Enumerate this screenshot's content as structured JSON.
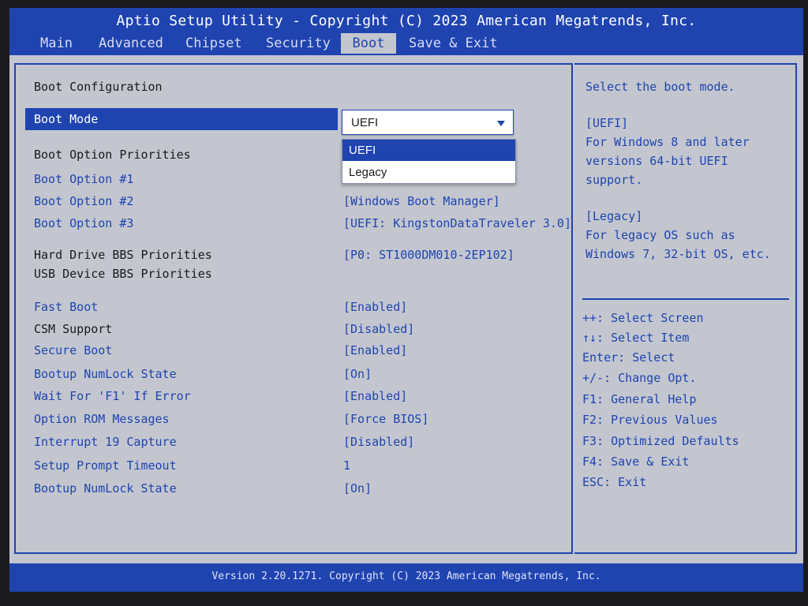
{
  "app_title": "Aptio Setup Utility - Copyright (C) 2023 American Megatrends, Inc.",
  "tabs": [
    {
      "label": "Main"
    },
    {
      "label": "Advanced"
    },
    {
      "label": "Chipset"
    },
    {
      "label": "Security"
    },
    {
      "label": "Boot",
      "active": true
    },
    {
      "label": "Save & Exit"
    }
  ],
  "main": {
    "section_boot_config": "Boot Configuration",
    "boot_mode": {
      "label": "Boot Mode",
      "value": "UEFI",
      "options": [
        "UEFI",
        "Legacy"
      ],
      "selected_option": "UEFI"
    },
    "section_priorities": "Boot Option Priorities",
    "boot_options": [
      {
        "label": "Boot Option #1",
        "value": ""
      },
      {
        "label": "Boot Option #2",
        "value": "[Windows Boot Manager]"
      },
      {
        "label": "Boot Option #3",
        "value": "[UEFI: KingstonDataTraveler 3.0]"
      }
    ],
    "hdd_bbs": {
      "label": "Hard Drive BBS Priorities",
      "value": "[P0: ST1000DM010-2EP102]"
    },
    "usb_bbs": {
      "label": "USB Device BBS Priorities"
    },
    "settings": [
      {
        "label": "Fast Boot",
        "value": "[Enabled]",
        "style": "link"
      },
      {
        "label": "CSM Support",
        "value": "[Disabled]",
        "style": "plain"
      },
      {
        "label": "Secure Boot",
        "value": "[Enabled]",
        "style": "link"
      },
      {
        "label": "Bootup NumLock State",
        "value": "[On]",
        "style": "link"
      },
      {
        "label": "Wait For 'F1' If Error",
        "value": "[Enabled]",
        "style": "link"
      },
      {
        "label": "Option ROM Messages",
        "value": "[Force BIOS]",
        "style": "link"
      },
      {
        "label": "Interrupt 19 Capture",
        "value": "[Disabled]",
        "style": "link"
      },
      {
        "label": "Setup Prompt Timeout",
        "value": "1",
        "style": "link"
      },
      {
        "label": "Bootup NumLock State",
        "value": "[On]",
        "style": "link"
      }
    ]
  },
  "help": {
    "lines": [
      "Select the boot mode.",
      "[UEFI]",
      "For Windows 8 and later",
      "versions 64-bit UEFI",
      "support.",
      "[Legacy]",
      "For legacy OS such as",
      "Windows 7, 32-bit OS, etc."
    ],
    "keys": [
      "++: Select Screen",
      "↑↓: Select Item",
      "Enter: Select",
      "+/-: Change Opt.",
      "F1: General Help",
      "F2: Previous Values",
      "F3: Optimized Defaults",
      "F4: Save & Exit",
      "ESC: Exit"
    ]
  },
  "footer": "Version 2.20.1271. Copyright (C) 2023 American Megatrends, Inc.",
  "colors": {
    "accent": "#1f44b0",
    "background": "#c3c6cf",
    "text": "#1a1a1a",
    "highlight_text": "#ffffff"
  }
}
